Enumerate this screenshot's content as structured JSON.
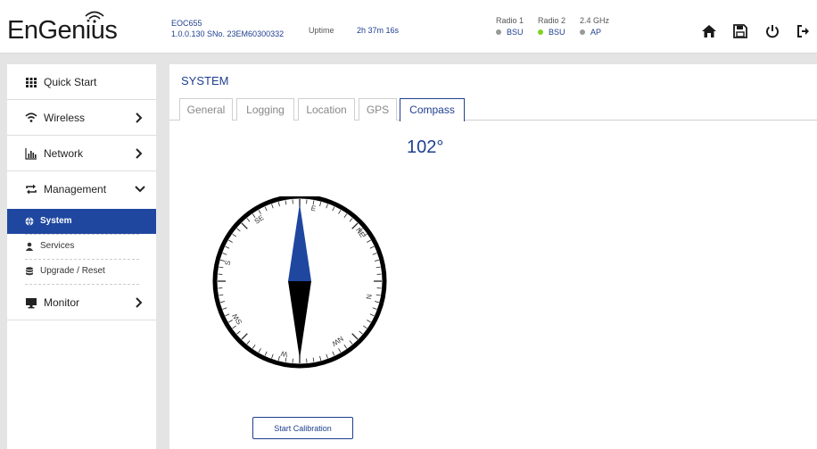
{
  "header": {
    "logo_text": "EnGenius",
    "model": "EOC655",
    "firmware_serial": "1.0.0.130 SNo. 23EM60300332",
    "uptime_label": "Uptime",
    "uptime_value": "2h 37m 16s",
    "radios": [
      {
        "name": "Radio 1",
        "status": "BSU",
        "color": "#999999"
      },
      {
        "name": "Radio 2",
        "status": "BSU",
        "color": "#7ed321"
      },
      {
        "name": "2.4 GHz",
        "status": "AP",
        "color": "#999999"
      }
    ],
    "icons": [
      "home-icon",
      "save-icon",
      "power-icon",
      "logout-icon"
    ]
  },
  "sidebar": {
    "items": [
      {
        "label": "Quick Start",
        "icon": "grid-icon"
      },
      {
        "label": "Wireless",
        "icon": "wifi-icon"
      },
      {
        "label": "Network",
        "icon": "bar-chart-icon"
      },
      {
        "label": "Management",
        "icon": "transfer-icon"
      },
      {
        "label": "Monitor",
        "icon": "monitor-icon"
      }
    ],
    "subitems": [
      {
        "label": "System",
        "icon": "globe-icon",
        "active": true
      },
      {
        "label": "Services",
        "icon": "user-icon"
      },
      {
        "label": "Upgrade / Reset",
        "icon": "database-icon"
      }
    ]
  },
  "main": {
    "title": "SYSTEM",
    "tabs": [
      {
        "label": "General"
      },
      {
        "label": "Logging"
      },
      {
        "label": "Location"
      },
      {
        "label": "GPS"
      },
      {
        "label": "Compass",
        "active": true
      }
    ],
    "heading": "102°",
    "compass_labels": [
      "E",
      "NE",
      "N",
      "NW",
      "W",
      "SW",
      "S",
      "SE"
    ],
    "calibrate_label": "Start Calibration"
  },
  "colors": {
    "accent": "#1f3f8f",
    "active_nav": "#1f47a0",
    "needle_north": "#1f47a0",
    "needle_south": "#000000"
  }
}
